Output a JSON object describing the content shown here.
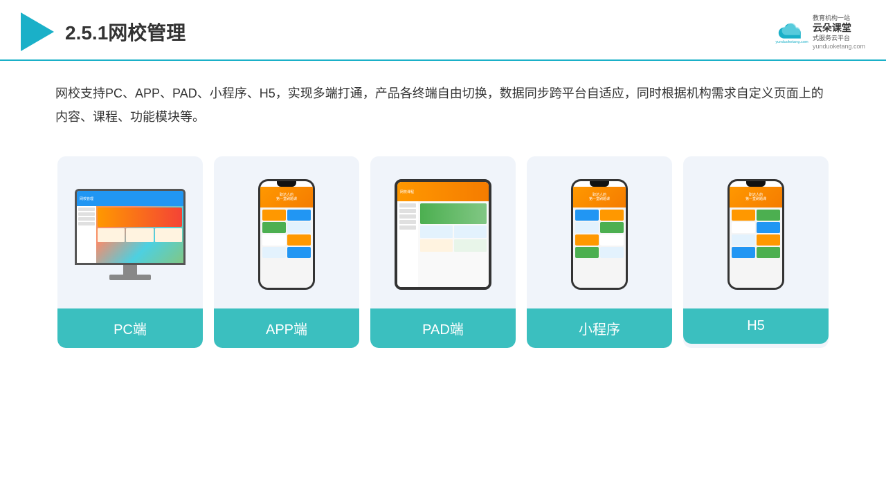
{
  "header": {
    "title": "2.5.1网校管理",
    "brand": {
      "name": "云朵课堂",
      "url": "yunduoketang.com",
      "slogan": "教育机构一站\n式服务云平台"
    }
  },
  "description": {
    "text": "网校支持PC、APP、PAD、小程序、H5，实现多端打通，产品各终端自由切换，数据同步跨平台自适应，同时根据机构需求自定义页面上的内容、课程、功能模块等。"
  },
  "cards": [
    {
      "id": "pc",
      "label": "PC端"
    },
    {
      "id": "app",
      "label": "APP端"
    },
    {
      "id": "pad",
      "label": "PAD端"
    },
    {
      "id": "mini",
      "label": "小程序"
    },
    {
      "id": "h5",
      "label": "H5"
    }
  ],
  "colors": {
    "accent": "#3bbfbf",
    "header_border": "#1ab0c8",
    "card_bg": "#f0f4fa"
  }
}
